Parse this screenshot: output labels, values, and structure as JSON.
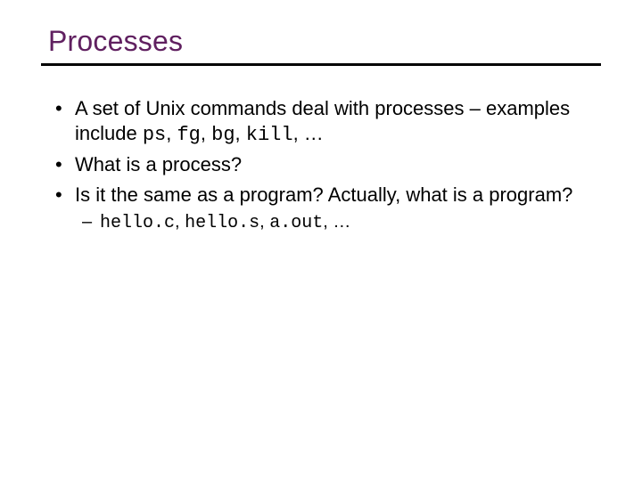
{
  "title": "Processes",
  "bullets": {
    "b1_pre": "A set of Unix commands deal with processes – examples include ",
    "b1_c1": "ps",
    "b1_s1": ", ",
    "b1_c2": "fg",
    "b1_s2": ", ",
    "b1_c3": "bg",
    "b1_s3": ", ",
    "b1_c4": "kill",
    "b1_post": ", …",
    "b2": "What is a process?",
    "b3": "Is it the same as a program?  Actually, what is a program?",
    "b3_sub_c1": "hello.c",
    "b3_sub_s1": ", ",
    "b3_sub_c2": "hello.s",
    "b3_sub_s2": ", ",
    "b3_sub_c3": "a.out",
    "b3_sub_post": ", …"
  }
}
